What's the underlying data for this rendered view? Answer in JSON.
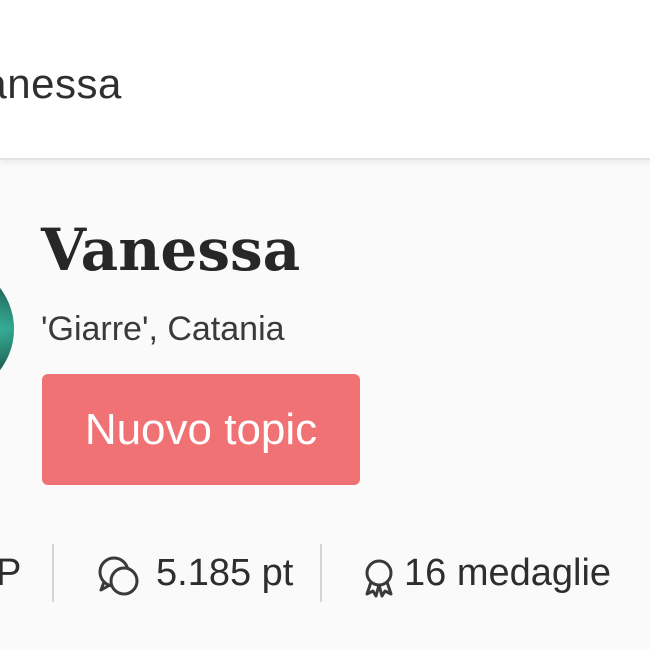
{
  "header": {
    "title": "Vanessa"
  },
  "profile": {
    "name": "Vanessa",
    "location": "'Giarre', Catania",
    "new_topic_label": "Nuovo topic"
  },
  "stats": {
    "first_partial": "P",
    "points": "5.185 pt",
    "medals": "16 medaglie",
    "points_icon": "speech-bubbles-icon",
    "medals_icon": "medal-icon"
  },
  "colors": {
    "accent": "#f07274",
    "header_bg": "#ffffff",
    "page_bg": "#fafafa"
  }
}
